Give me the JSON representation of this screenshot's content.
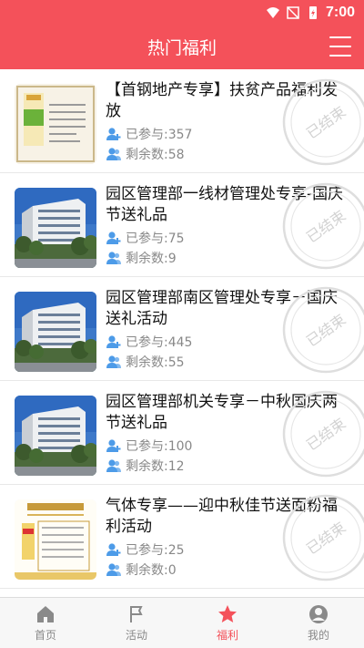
{
  "status_bar": {
    "time": "7:00"
  },
  "header": {
    "title": "热门福利",
    "menu_icon": "menu-icon"
  },
  "colors": {
    "brand": "#f4515a",
    "stamp": "#d8d8d8",
    "meta_icon": "#4d9be8"
  },
  "items": [
    {
      "title": "【首钢地产专享】扶贫产品福利发放",
      "joined": "已参与:357",
      "remaining": "剩余数:58",
      "stamp": "已结束",
      "thumb": "product"
    },
    {
      "title": "园区管理部一线材管理处专享-国庆节送礼品",
      "joined": "已参与:75",
      "remaining": "剩余数:9",
      "stamp": "已结束",
      "thumb": "building"
    },
    {
      "title": "园区管理部南区管理处专享－国庆送礼活动",
      "joined": "已参与:445",
      "remaining": "剩余数:55",
      "stamp": "已结束",
      "thumb": "building"
    },
    {
      "title": "园区管理部机关专享－中秋国庆两节送礼品",
      "joined": "已参与:100",
      "remaining": "剩余数:12",
      "stamp": "已结束",
      "thumb": "building"
    },
    {
      "title": "气体专享——迎中秋佳节送面粉福利活动",
      "joined": "已参与:25",
      "remaining": "剩余数:0",
      "stamp": "已结束",
      "thumb": "flour"
    }
  ],
  "tabs": [
    {
      "label": "首页",
      "icon": "home-icon",
      "active": false
    },
    {
      "label": "活动",
      "icon": "flag-icon",
      "active": false
    },
    {
      "label": "福利",
      "icon": "star-icon",
      "active": true
    },
    {
      "label": "我的",
      "icon": "user-icon",
      "active": false
    }
  ]
}
